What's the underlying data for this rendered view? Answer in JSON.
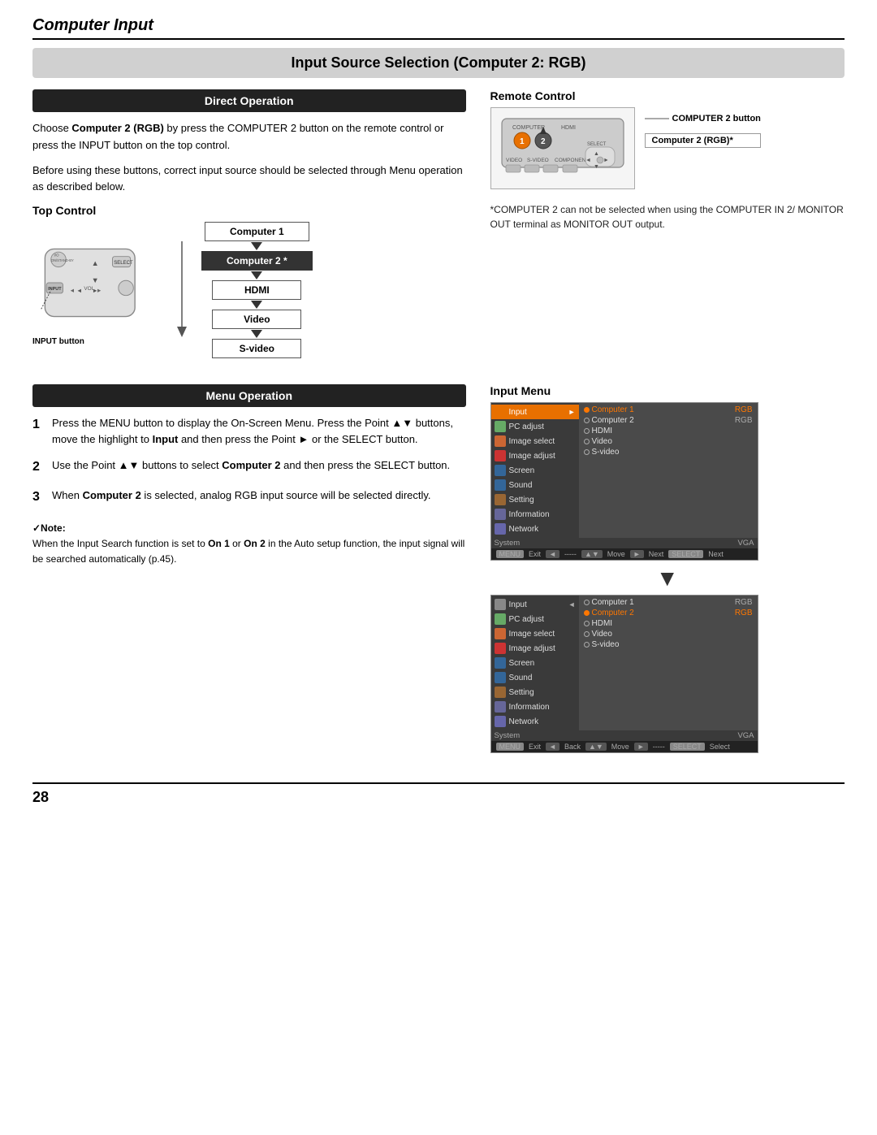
{
  "header": {
    "title": "Computer Input"
  },
  "section_title": "Input Source Selection (Computer 2: RGB)",
  "direct_operation": {
    "bar_label": "Direct Operation",
    "para1": "Choose Computer 2 (RGB) by press the COMPUTER 2 button on the remote control or press the INPUT button on the top control.",
    "para1_bold": "Computer 2 (RGB)",
    "para2": "Before using these buttons, correct input source should be selected through Menu operation as described below."
  },
  "remote_control": {
    "label": "Remote Control",
    "computer2_button_label": "COMPUTER 2 button",
    "computer2_rgb_badge": "Computer 2 (RGB)*"
  },
  "top_control": {
    "label": "Top Control",
    "input_button_label": "INPUT button",
    "flow": [
      {
        "label": "Computer 1",
        "highlight": false
      },
      {
        "label": "Computer 2 *",
        "highlight": true
      },
      {
        "label": "HDMI",
        "highlight": false
      },
      {
        "label": "Video",
        "highlight": false
      },
      {
        "label": "S-video",
        "highlight": false
      }
    ]
  },
  "note_asterisk": "*COMPUTER 2 can not be selected when using the COMPUTER IN 2/ MONITOR OUT terminal as MONITOR OUT output.",
  "menu_operation": {
    "bar_label": "Menu Operation",
    "steps": [
      {
        "num": "1",
        "text": "Press the MENU button to display the On-Screen Menu. Press the Point ▲▼ buttons, move the highlight to Input and then press the Point ► or the SELECT button."
      },
      {
        "num": "2",
        "text": "Use the Point ▲▼ buttons to select Computer 2 and then press the SELECT button.",
        "bold": "Computer 2"
      },
      {
        "num": "3",
        "text": "When Computer 2 is selected, analog RGB input source will be selected directly.",
        "bold": "Computer 2"
      }
    ]
  },
  "input_menu": {
    "label": "Input Menu",
    "menu1": {
      "items": [
        {
          "icon": "input",
          "label": "Input",
          "active": true
        },
        {
          "icon": "pc",
          "label": "PC adjust",
          "active": false
        },
        {
          "icon": "image-select",
          "label": "Image select",
          "active": false
        },
        {
          "icon": "image-adjust",
          "label": "Image adjust",
          "active": false
        },
        {
          "icon": "screen",
          "label": "Screen",
          "active": false
        },
        {
          "icon": "sound",
          "label": "Sound",
          "active": false
        },
        {
          "icon": "setting",
          "label": "Setting",
          "active": false
        },
        {
          "icon": "info",
          "label": "Information",
          "active": false
        },
        {
          "icon": "network",
          "label": "Network",
          "active": false
        }
      ],
      "options": [
        {
          "radio": true,
          "selected": true,
          "label": "Computer 1",
          "val": "RGB"
        },
        {
          "radio": true,
          "selected": false,
          "label": "Computer 2",
          "val": "RGB"
        },
        {
          "radio": false,
          "selected": false,
          "label": "HDMI",
          "val": ""
        },
        {
          "radio": false,
          "selected": false,
          "label": "Video",
          "val": ""
        },
        {
          "radio": false,
          "selected": false,
          "label": "S-video",
          "val": ""
        }
      ],
      "system_label": "System",
      "system_val": "VGA",
      "bottom": [
        {
          "key": "MENU",
          "key_class": "menu-key",
          "action": "Exit"
        },
        {
          "key": "◄",
          "action": "-----"
        },
        {
          "key": "▲▼",
          "action": "Move"
        },
        {
          "key": "►",
          "action": "Next"
        },
        {
          "key": "SELECT",
          "key_class": "menu-key",
          "action": "Next"
        }
      ]
    },
    "menu2": {
      "items": [
        {
          "icon": "input",
          "label": "Input",
          "active": false
        },
        {
          "icon": "pc",
          "label": "PC adjust",
          "active": false
        },
        {
          "icon": "image-select",
          "label": "Image select",
          "active": false
        },
        {
          "icon": "image-adjust",
          "label": "Image adjust",
          "active": false
        },
        {
          "icon": "screen",
          "label": "Screen",
          "active": false
        },
        {
          "icon": "sound",
          "label": "Sound",
          "active": false
        },
        {
          "icon": "setting",
          "label": "Setting",
          "active": false
        },
        {
          "icon": "info",
          "label": "Information",
          "active": false
        },
        {
          "icon": "network",
          "label": "Network",
          "active": false
        }
      ],
      "options": [
        {
          "radio": true,
          "selected": false,
          "label": "Computer 1",
          "val": "RGB"
        },
        {
          "radio": true,
          "selected": true,
          "label": "Computer 2",
          "val": "RGB"
        },
        {
          "radio": false,
          "selected": false,
          "label": "HDMI",
          "val": ""
        },
        {
          "radio": false,
          "selected": false,
          "label": "Video",
          "val": ""
        },
        {
          "radio": false,
          "selected": false,
          "label": "S-video",
          "val": ""
        }
      ],
      "system_label": "System",
      "system_val": "VGA",
      "bottom": [
        {
          "key": "MENU",
          "key_class": "menu-key",
          "action": "Exit"
        },
        {
          "key": "◄",
          "action": "Back"
        },
        {
          "key": "▲▼",
          "action": "Move"
        },
        {
          "key": "►",
          "action": "-----"
        },
        {
          "key": "SELECT",
          "key_class": "menu-key",
          "action": "Select"
        }
      ]
    }
  },
  "note": {
    "check": "✓Note:",
    "text": "When the Input Search function is set to On 1 or On 2 in the Auto setup function, the input signal will be searched automatically (p.45).",
    "bold_on1": "On 1",
    "bold_on2": "On 2"
  },
  "page_number": "28"
}
